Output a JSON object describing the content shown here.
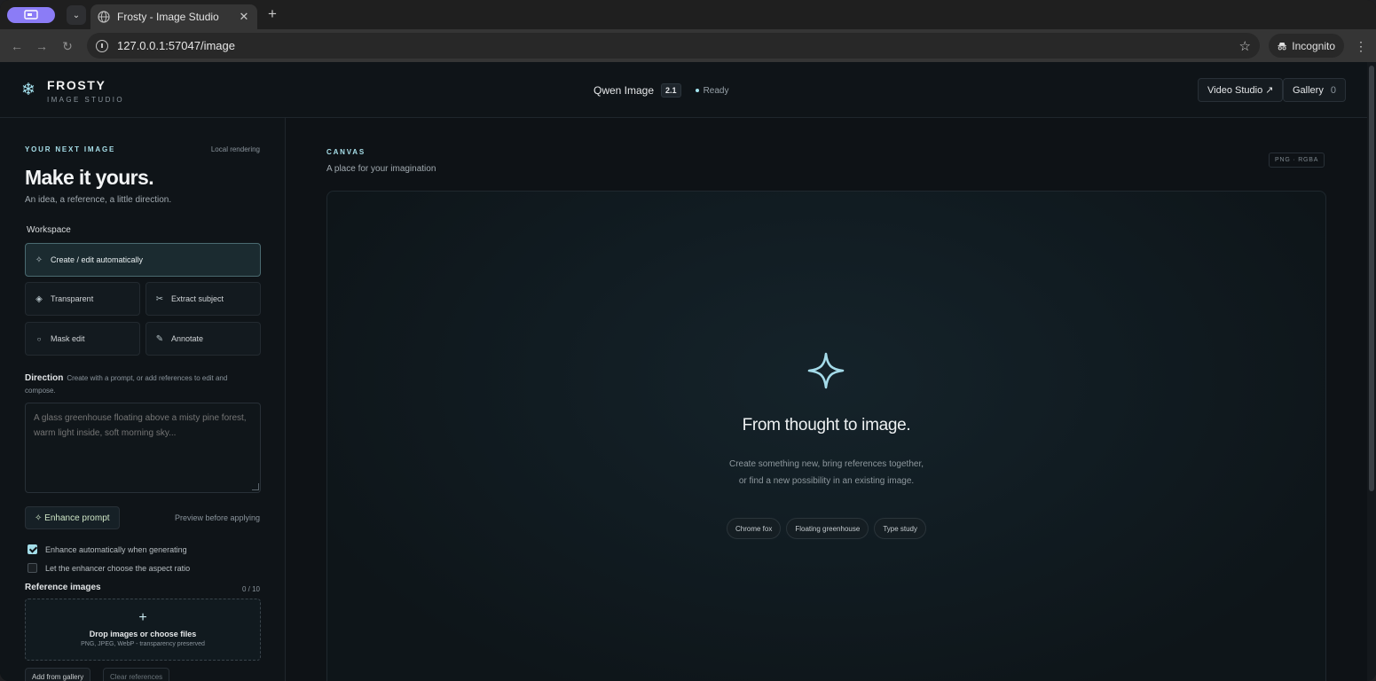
{
  "browser": {
    "tab_title": "Frosty - Image Studio",
    "url": "127.0.0.1:57047/image",
    "incognito_label": "Incognito"
  },
  "header": {
    "brand_name": "FROSTY",
    "brand_sub": "IMAGE STUDIO",
    "model_name": "Qwen Image",
    "model_version": "2.1",
    "status": "Ready",
    "video_studio_label": "Video Studio ↗",
    "gallery_label": "Gallery",
    "gallery_count": "0"
  },
  "sidebar": {
    "eyebrow": "YOUR NEXT IMAGE",
    "local_label": "Local rendering",
    "hero_title": "Make it yours.",
    "hero_sub": "An idea, a reference, a little direction.",
    "workspace_label": "Workspace",
    "workspace": {
      "create": "Create / edit automatically",
      "transparent": "Transparent",
      "extract": "Extract subject",
      "mask": "Mask edit",
      "annotate": "Annotate"
    },
    "direction_title": "Direction",
    "direction_help": "Create with a prompt, or add references to edit and compose.",
    "prompt_placeholder": "A glass greenhouse floating above a misty pine forest, warm light inside, soft morning sky...",
    "enhance_label": "✧ Enhance prompt",
    "preview_label": "Preview before applying",
    "check_auto": "Enhance automatically when generating",
    "check_aspect": "Let the enhancer choose the aspect ratio",
    "ref_label": "Reference images",
    "ref_count": "0 / 10",
    "dropzone_title": "Drop images or choose files",
    "dropzone_sub": "PNG, JPEG, WebP - transparency preserved",
    "add_gallery": "Add from gallery",
    "clear_refs": "Clear references"
  },
  "canvas": {
    "eyebrow": "CANVAS",
    "sub": "A place for your imagination",
    "format": "PNG · RGBA",
    "title": "From thought to image.",
    "desc_line1": "Create something new, bring references together,",
    "desc_line2": "or find a new possibility in an existing image.",
    "chips": [
      "Chrome fox",
      "Floating greenhouse",
      "Type study"
    ]
  }
}
